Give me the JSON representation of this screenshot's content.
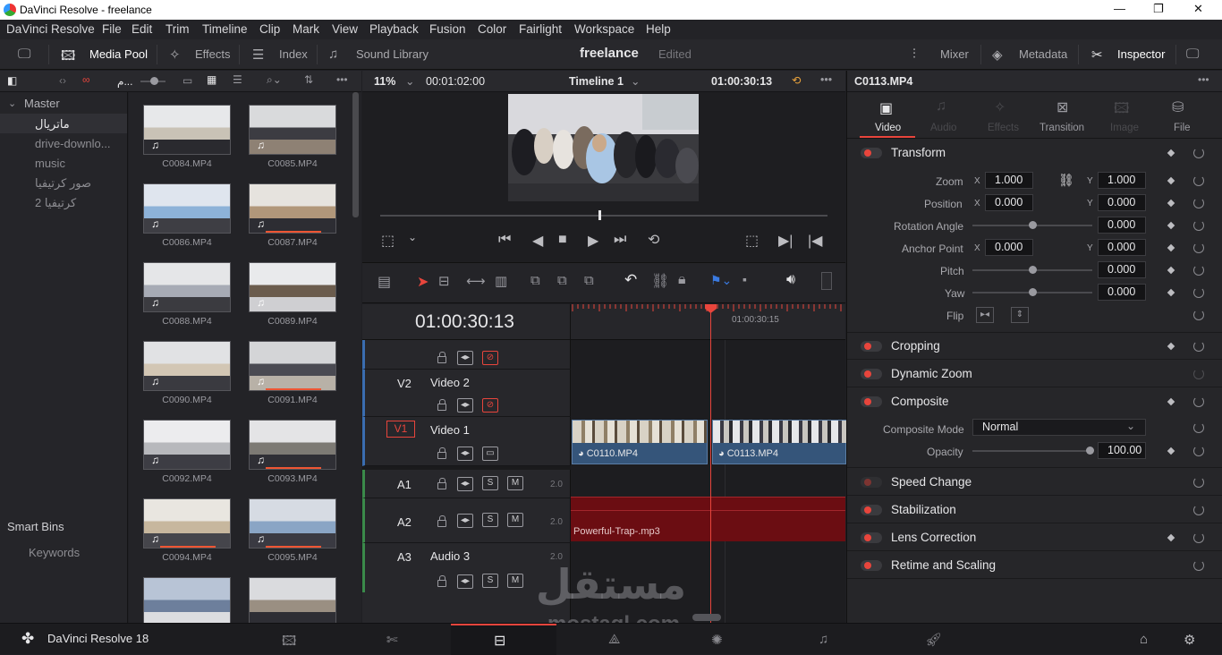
{
  "window": {
    "title": "DaVinci Resolve - freelance"
  },
  "menu": [
    "DaVinci Resolve",
    "File",
    "Edit",
    "Trim",
    "Timeline",
    "Clip",
    "Mark",
    "View",
    "Playback",
    "Fusion",
    "Color",
    "Fairlight",
    "Workspace",
    "Help"
  ],
  "toolbar": {
    "media_pool": "Media Pool",
    "effects": "Effects",
    "index": "Index",
    "sound_library": "Sound Library",
    "project_name": "freelance",
    "project_status": "Edited",
    "mixer": "Mixer",
    "metadata": "Metadata",
    "inspector": "Inspector"
  },
  "bins": {
    "master": "Master",
    "items": [
      "ماتريال",
      "drive-downlo...",
      "music",
      "صور كرتيفيا",
      "كرتيفيا 2"
    ],
    "smart_bins": "Smart Bins",
    "keywords": "Keywords",
    "search_label": "م..."
  },
  "media": {
    "clips": [
      "C0084.MP4",
      "C0085.MP4",
      "C0086.MP4",
      "C0087.MP4",
      "C0088.MP4",
      "C0089.MP4",
      "C0090.MP4",
      "C0091.MP4",
      "C0092.MP4",
      "C0093.MP4",
      "C0094.MP4",
      "C0095.MP4",
      "",
      ""
    ]
  },
  "viewer": {
    "zoom": "11%",
    "source_duration": "00:01:02:00",
    "timeline_name": "Timeline 1",
    "timecode": "01:00:30:13"
  },
  "timeline": {
    "timecode": "01:00:30:13",
    "ruler_label": "01:00:30:15",
    "tracks": {
      "v2_id": "V2",
      "v2_name": "Video 2",
      "v1_id": "V1",
      "v1_name": "Video 1",
      "a1_id": "A1",
      "a2_id": "A2",
      "a3_id": "A3",
      "a3_name": "Audio 3",
      "a_level": "2.0",
      "solo": "S",
      "mute": "M"
    },
    "clip1": "C0110.MP4",
    "clip2": "C0113.MP4",
    "audio_clip": "Powerful-Trap-.mp3"
  },
  "inspector": {
    "clip_name": "C0113.MP4",
    "tabs": [
      "Video",
      "Audio",
      "Effects",
      "Transition",
      "Image",
      "File"
    ],
    "transform": {
      "title": "Transform",
      "zoom_label": "Zoom",
      "zoom_x": "1.000",
      "zoom_y": "1.000",
      "position_label": "Position",
      "position_x": "0.000",
      "position_y": "0.000",
      "rotation_label": "Rotation Angle",
      "rotation": "0.000",
      "anchor_label": "Anchor Point",
      "anchor_x": "0.000",
      "anchor_y": "0.000",
      "pitch_label": "Pitch",
      "pitch": "0.000",
      "yaw_label": "Yaw",
      "yaw": "0.000",
      "flip_label": "Flip",
      "x": "X",
      "y": "Y"
    },
    "sections": [
      "Cropping",
      "Dynamic Zoom",
      "Composite",
      "Speed Change",
      "Stabilization",
      "Lens Correction",
      "Retime and Scaling"
    ],
    "composite": {
      "mode_label": "Composite Mode",
      "mode": "Normal",
      "opacity_label": "Opacity",
      "opacity": "100.00"
    }
  },
  "bottom": {
    "app_version": "DaVinci Resolve 18"
  },
  "watermark": {
    "arabic": "مستقل",
    "latin": "mostaql.com"
  },
  "colors": {
    "accent": "#e8453c",
    "audio_clip": "#6b0d12",
    "video_clip": "#35557a"
  }
}
